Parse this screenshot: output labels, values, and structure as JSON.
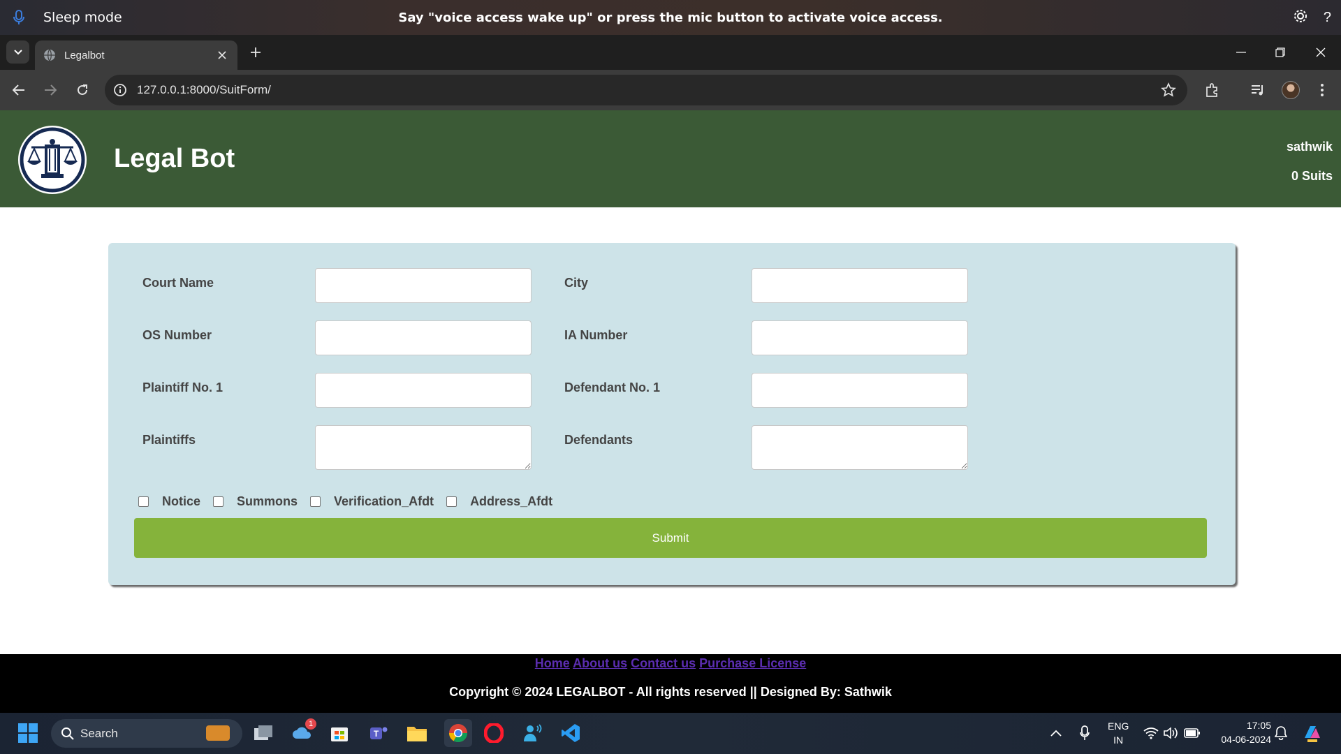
{
  "voice_access": {
    "status": "Sleep mode",
    "message": "Say \"voice access wake up\" or press the mic button to activate voice access."
  },
  "browser": {
    "tab_title": "Legalbot",
    "url": "127.0.0.1:8000/SuitForm/"
  },
  "header": {
    "title": "Legal Bot",
    "username": "sathwik",
    "suits_count": "0 Suits"
  },
  "form": {
    "court_name_label": "Court Name",
    "city_label": "City",
    "os_number_label": "OS Number",
    "ia_number_label": "IA Number",
    "plaintiff1_label": "Plaintiff No. 1",
    "defendant1_label": "Defendant No. 1",
    "plaintiffs_label": "Plaintiffs",
    "defendants_label": "Defendants",
    "court_name": "",
    "city": "",
    "os_number": "",
    "ia_number": "",
    "plaintiff1": "",
    "defendant1": "",
    "plaintiffs": "",
    "defendants": "",
    "checkboxes": {
      "notice": "Notice",
      "summons": "Summons",
      "verification": "Verification_Afdt",
      "address": "Address_Afdt"
    },
    "submit_label": "Submit"
  },
  "footer": {
    "links": {
      "home": "Home",
      "about": "About us",
      "contact": "Contact us",
      "purchase": "Purchase License"
    },
    "copyright": "Copyright © 2024 LEGALBOT - All rights reserved || Designed By: Sathwik"
  },
  "taskbar": {
    "search_label": "Search",
    "weather_badge": "1",
    "lang_line1": "ENG",
    "lang_line2": "IN",
    "time": "17:05",
    "date": "04-06-2024"
  },
  "colors": {
    "header_bg": "#3b5a36",
    "card_bg": "#cde3e8",
    "submit_bg": "#85b33b",
    "footer_link": "#5b2db0"
  }
}
